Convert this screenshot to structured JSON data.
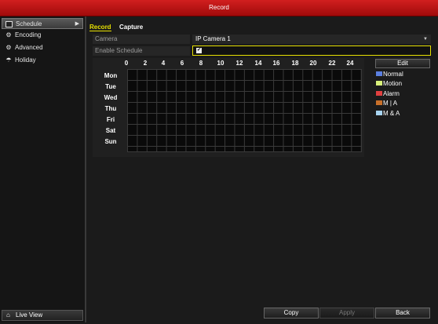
{
  "window": {
    "title": "Record"
  },
  "sidebar": {
    "items": [
      {
        "label": "Schedule",
        "icon": "schedule-icon",
        "active": true
      },
      {
        "label": "Encoding",
        "icon": "gear-icon"
      },
      {
        "label": "Advanced",
        "icon": "advanced-icon"
      },
      {
        "label": "Holiday",
        "icon": "holiday-icon"
      }
    ],
    "live_view": "Live View"
  },
  "tabs": [
    {
      "label": "Record",
      "active": true
    },
    {
      "label": "Capture"
    }
  ],
  "form": {
    "camera_label": "Camera",
    "camera_value": "IP Camera 1",
    "enable_label": "Enable Schedule",
    "enable_checked": true
  },
  "schedule": {
    "hours": [
      "0",
      "2",
      "4",
      "6",
      "8",
      "10",
      "12",
      "14",
      "16",
      "18",
      "20",
      "22",
      "24"
    ],
    "days": [
      "Mon",
      "Tue",
      "Wed",
      "Thu",
      "Fri",
      "Sat",
      "Sun"
    ]
  },
  "legend": {
    "edit_label": "Edit",
    "items": [
      {
        "label": "Normal",
        "color": "#5b7fe0"
      },
      {
        "label": "Motion",
        "color": "#d8f07a"
      },
      {
        "label": "Alarm",
        "color": "#e04040"
      },
      {
        "label": "M | A",
        "color": "#c8702a"
      },
      {
        "label": "M & A",
        "color": "#a8d4f0"
      }
    ]
  },
  "buttons": {
    "copy": "Copy",
    "apply": "Apply",
    "back": "Back"
  }
}
